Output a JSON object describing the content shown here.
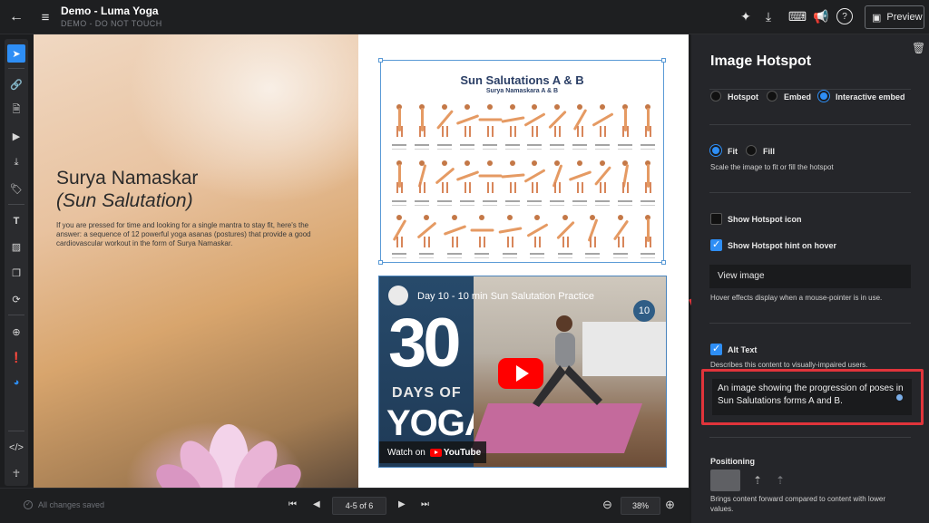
{
  "topbar": {
    "title": "Demo - Luma Yoga",
    "subtitle": "DEMO - DO NOT TOUCH",
    "preview_label": "Preview"
  },
  "page_left": {
    "heading": "Surya Namaskar",
    "subheading": "(Sun Salutation)",
    "body": "If you are pressed for time and looking for a single mantra to stay fit, here's the answer: a sequence of 12 powerful yoga asanas (postures) that provide a good cardiovascular workout in the form of Surya Namaskar."
  },
  "poster": {
    "title": "Sun Salutations A & B",
    "subtitle": "Surya Namaskara A & B"
  },
  "video": {
    "title": "Day 10 - 10 min Sun Salutation Practice",
    "big_number": "30",
    "days_of": "DAYS OF",
    "yoga": "YOGA",
    "watch_on": "Watch on",
    "youtube": "YouTube",
    "badge": "10"
  },
  "bottombar": {
    "saved": "All changes saved",
    "page_indicator": "4-5 of 6",
    "zoom": "38%"
  },
  "panel": {
    "title": "Image Hotspot",
    "type_options": [
      "Hotspot",
      "Embed",
      "Interactive embed"
    ],
    "type_selected": "Interactive embed",
    "fit_options": [
      "Fit",
      "Fill"
    ],
    "fit_selected": "Fit",
    "fit_help": "Scale the image to fit or fill the hotspot",
    "show_icon_label": "Show Hotspot icon",
    "show_hint_label": "Show Hotspot hint on hover",
    "hint_value": "View image",
    "hover_help": "Hover effects display when a mouse-pointer is in use.",
    "alt_label": "Alt Text",
    "alt_help": "Describes this content to visually-impaired users.",
    "alt_value": "An image showing the progression of poses in Sun Salutations forms A and B.",
    "positioning_label": "Positioning",
    "positioning_help": "Brings content forward compared to content with lower values."
  },
  "colors": {
    "accent": "#2e8ef5",
    "highlight": "#e0343b",
    "panel_bg": "#25262a"
  }
}
